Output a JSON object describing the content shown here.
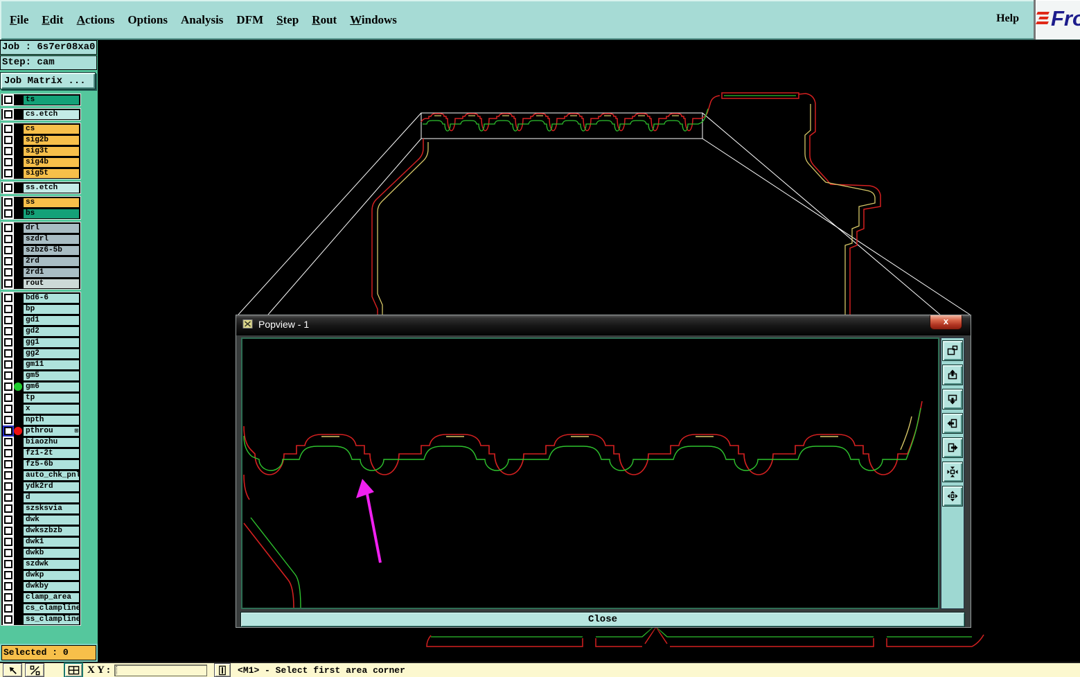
{
  "menu": {
    "items": [
      {
        "label": "File",
        "underline": true
      },
      {
        "label": "Edit",
        "underline": true
      },
      {
        "label": "Actions",
        "underline": true
      },
      {
        "label": "Options",
        "underline": false
      },
      {
        "label": "Analysis",
        "underline": false
      },
      {
        "label": "DFM",
        "underline": false
      },
      {
        "label": "Step",
        "underline": true
      },
      {
        "label": "Rout",
        "underline": true
      },
      {
        "label": "Windows",
        "underline": true
      }
    ],
    "help_label": "Help",
    "logo_text": "Fro"
  },
  "job_panel": {
    "job_label": "Job : 6s7er08xa0",
    "step_label": "Step: cam",
    "matrix_button_label": "Job Matrix ..."
  },
  "layer_groups": [
    {
      "rows": [
        {
          "name": "ts",
          "color": "green"
        }
      ]
    },
    {
      "rows": [
        {
          "name": "cs.etch",
          "color": "cyan"
        }
      ]
    },
    {
      "rows": [
        {
          "name": "cs",
          "color": "orange"
        },
        {
          "name": "sig2b",
          "color": "orange"
        },
        {
          "name": "sig3t",
          "color": "orange"
        },
        {
          "name": "sig4b",
          "color": "orange"
        },
        {
          "name": "sig5t",
          "color": "orange"
        }
      ]
    },
    {
      "rows": [
        {
          "name": "ss.etch",
          "color": "cyan"
        }
      ]
    },
    {
      "rows": [
        {
          "name": "ss",
          "color": "orange"
        },
        {
          "name": "bs",
          "color": "green"
        }
      ]
    },
    {
      "rows": [
        {
          "name": "drl",
          "color": "bluegray"
        },
        {
          "name": "szdrl",
          "color": "bluegray"
        },
        {
          "name": "szbz6-5b",
          "color": "bluegray"
        },
        {
          "name": "2rd",
          "color": "bluegray"
        },
        {
          "name": "2rd1",
          "color": "bluegray"
        },
        {
          "name": "rout",
          "color": "lightgray"
        }
      ]
    },
    {
      "rows": [
        {
          "name": "bd6-6"
        },
        {
          "name": "bp"
        },
        {
          "name": "gd1"
        },
        {
          "name": "gd2"
        },
        {
          "name": "gg1"
        },
        {
          "name": "gg2"
        },
        {
          "name": "gm11"
        },
        {
          "name": "gm5"
        },
        {
          "name": "gm6",
          "dot": "green"
        },
        {
          "name": "tp"
        },
        {
          "name": "x"
        },
        {
          "name": "npth"
        },
        {
          "name": "pthrou",
          "dot": "red",
          "selected": true,
          "badge": "⊞"
        },
        {
          "name": "biaozhu"
        },
        {
          "name": "fz1-2t"
        },
        {
          "name": "fz5-6b"
        },
        {
          "name": "auto_chk_pnl"
        },
        {
          "name": "ydk2rd"
        },
        {
          "name": "d"
        },
        {
          "name": "szsksvia"
        },
        {
          "name": "dwk"
        },
        {
          "name": "dwkszbzb"
        },
        {
          "name": "dwk1"
        },
        {
          "name": "dwkb"
        },
        {
          "name": "szdwk"
        },
        {
          "name": "dwkp"
        },
        {
          "name": "dwkby"
        },
        {
          "name": "clamp_area"
        },
        {
          "name": "cs_clampline"
        },
        {
          "name": "ss_clampline"
        }
      ]
    }
  ],
  "selected_bar": {
    "label": "Selected : 0"
  },
  "bottom_bar": {
    "xy_label": "X Y :",
    "coord_input_value": "",
    "status_text": "<M1> - Select first area corner",
    "icons": [
      "select-arrow-icon",
      "zoom-scale-icon",
      "grid-window-icon",
      "divider-icon"
    ]
  },
  "popup": {
    "title": "Popview - 1",
    "close_x": "x",
    "close_button_label": "Close",
    "titlebar_icon": "popview-window-icon",
    "toolbar_icons": [
      "copy-view-icon",
      "pan-up-icon",
      "pan-down-icon",
      "pan-left-icon",
      "pan-right-icon",
      "zoom-fit-icon",
      "zoom-expand-icon"
    ]
  },
  "colors": {
    "red_outline": "#d42020",
    "green_outline": "#2ec22e",
    "yellow_outline": "#d8c868",
    "magenta_arrow": "#f020f0",
    "selection_white": "#ffffff",
    "teal_ui": "#a6dbd5",
    "orange_layer": "#f7bf4a",
    "green_layer": "#14a178",
    "cyan_layer": "#c4ebe7",
    "bluegray_layer": "#a9bdc4",
    "sidebar_strip": "#55c79d"
  }
}
